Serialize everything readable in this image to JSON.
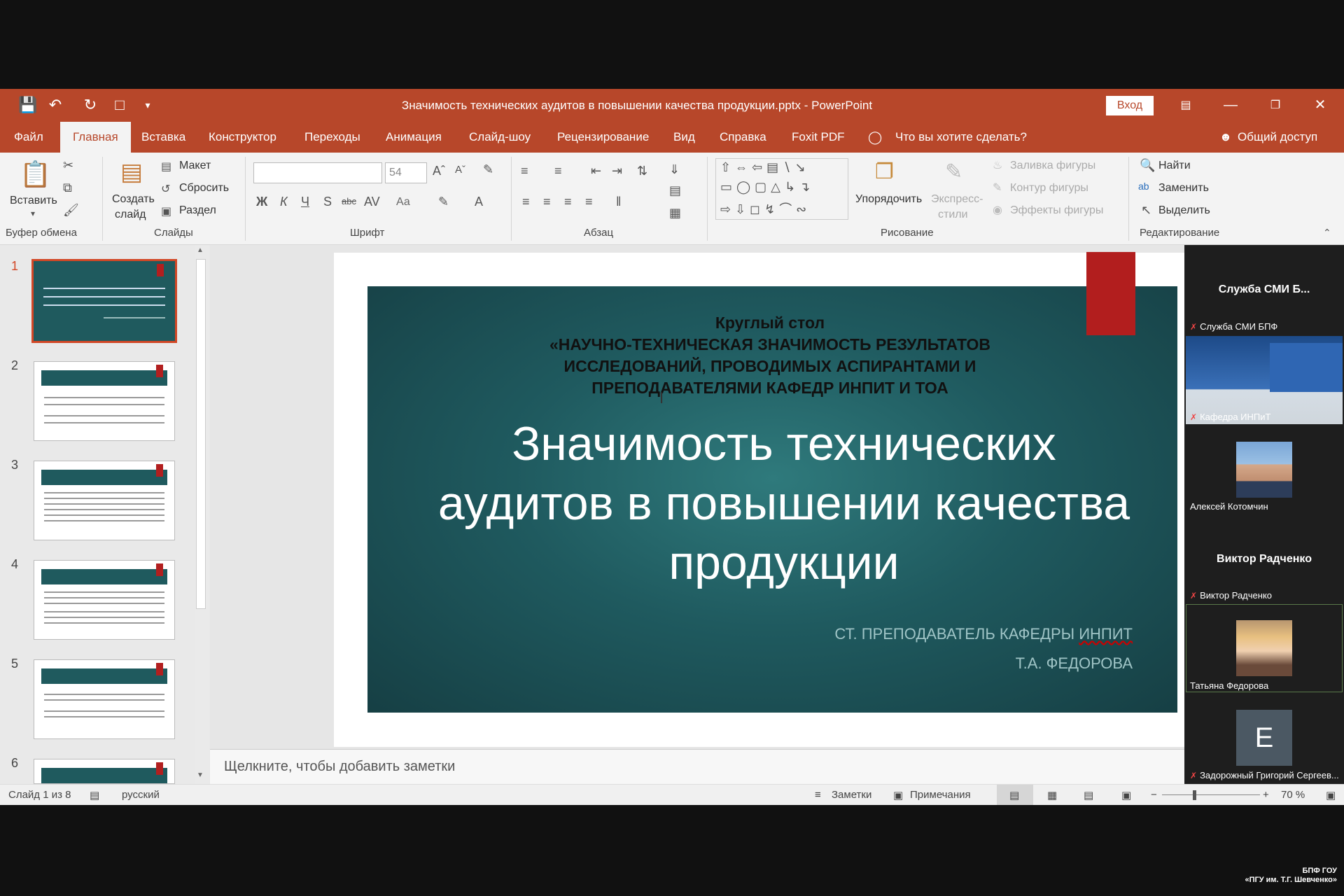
{
  "window": {
    "title": "Значимость технических аудитов в повышении качества продукции.pptx  -  PowerPoint",
    "login": "Вход"
  },
  "menu": {
    "tabs": [
      "Файл",
      "Главная",
      "Вставка",
      "Конструктор",
      "Переходы",
      "Анимация",
      "Слайд-шоу",
      "Рецензирование",
      "Вид",
      "Справка",
      "Foxit PDF"
    ],
    "tell_me": "Что вы хотите сделать?",
    "share": "Общий доступ"
  },
  "ribbon": {
    "clipboard": {
      "paste": "Вставить",
      "label": "Буфер обмена"
    },
    "slides": {
      "create": "Создать",
      "create2": "слайд",
      "layout": "Макет",
      "reset": "Сбросить",
      "section": "Раздел",
      "label": "Слайды"
    },
    "font": {
      "size": "54",
      "label": "Шрифт",
      "aa": "Аа"
    },
    "paragraph": {
      "label": "Абзац"
    },
    "drawing": {
      "arrange": "Упорядочить",
      "quick1": "Экспресс-",
      "quick2": "стили",
      "fill": "Заливка фигуры",
      "outline": "Контур фигуры",
      "effects": "Эффекты фигуры",
      "label": "Рисование"
    },
    "editing": {
      "find": "Найти",
      "replace": "Заменить",
      "select": "Выделить",
      "label": "Редактирование"
    }
  },
  "thumbnails": [
    "1",
    "2",
    "3",
    "4",
    "5",
    "6"
  ],
  "slide": {
    "kicker": "Круглый стол\n«НАУЧНО-ТЕХНИЧЕСКАЯ ЗНАЧИМОСТЬ РЕЗУЛЬТАТОВ\nИССЛЕДОВАНИЙ, ПРОВОДИМЫХ АСПИРАНТАМИ И\nПРЕПОДАВАТЕЛЯМИ КАФЕДР ИНПИТ И ТОА",
    "title": "Значимость технических аудитов в повышении качества продукции",
    "author_line1": "СТ. ПРЕПОДАВАТЕЛЬ КАФЕДРЫ ",
    "author_dept": "ИНПИТ",
    "author_line2": "Т.А. ФЕДОРОВА"
  },
  "notes_placeholder": "Щелкните, чтобы добавить заметки",
  "status": {
    "slide": "Слайд 1 из 8",
    "lang": "русский",
    "notes": "Заметки",
    "comments": "Примечания",
    "zoom": "70 %"
  },
  "participants": {
    "p1_big": "Служба СМИ Б...",
    "p1_label": "Служба СМИ БПФ",
    "p2_label": "Кафедра ИНПиТ",
    "p3_label": "Алексей Котомчин",
    "p4_big": "Виктор Радченко",
    "p4_label": "Виктор Радченко",
    "p5_label": "Татьяна Федорова",
    "p6_initial": "Е",
    "p6_label": "Задорожный Григорий Сергеев..."
  },
  "watermark": {
    "line1": "БПФ ГОУ",
    "line2": "«ПГУ им. Т.Г. Шевченко»"
  }
}
